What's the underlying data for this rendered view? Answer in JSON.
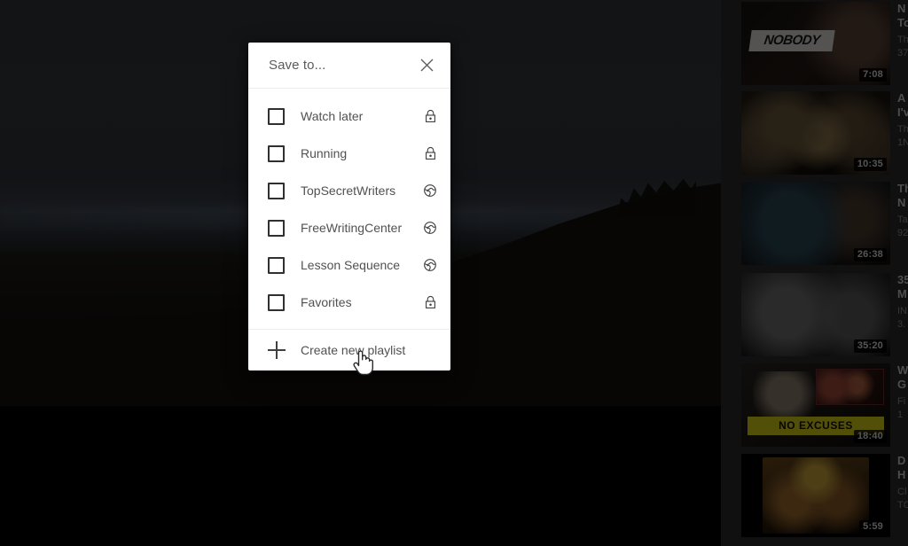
{
  "modal": {
    "title": "Save to...",
    "close_icon": "close-icon",
    "playlists": [
      {
        "label": "Watch later",
        "privacy": "private",
        "privacy_icon": "lock-icon",
        "checked": false
      },
      {
        "label": "Running",
        "privacy": "private",
        "privacy_icon": "lock-icon",
        "checked": false
      },
      {
        "label": "TopSecretWriters",
        "privacy": "public",
        "privacy_icon": "globe-icon",
        "checked": false
      },
      {
        "label": "FreeWritingCenter",
        "privacy": "public",
        "privacy_icon": "globe-icon",
        "checked": false
      },
      {
        "label": "Lesson Sequence",
        "privacy": "public",
        "privacy_icon": "globe-icon",
        "checked": false
      },
      {
        "label": "Favorites",
        "privacy": "private",
        "privacy_icon": "lock-icon",
        "checked": false
      }
    ],
    "create_label": "Create new playlist",
    "create_icon": "plus-icon"
  },
  "player": {
    "state": "playing",
    "scene": "dark dusk hillside landscape"
  },
  "sidebar": {
    "videos": [
      {
        "badge_text": "NOBODY",
        "duration": "7:08",
        "title_line1": "N",
        "title_line2": "To",
        "channel": "Th",
        "views": "37"
      },
      {
        "badge_text": "",
        "duration": "10:35",
        "title_line1": "A",
        "title_line2": "I'v",
        "channel": "Th",
        "views": "1N"
      },
      {
        "badge_text": "",
        "duration": "26:38",
        "title_line1": "Th",
        "title_line2": "N",
        "channel": "Ta",
        "views": "92"
      },
      {
        "badge_text": "",
        "duration": "35:20",
        "title_line1": "35",
        "title_line2": "M",
        "channel": "IN",
        "views": "3."
      },
      {
        "badge_text": "NO EXCUSES",
        "duration": "18:40",
        "title_line1": "W",
        "title_line2": "G",
        "channel": "Fi",
        "views": "1"
      },
      {
        "badge_text": "",
        "duration": "5:59",
        "title_line1": "D",
        "title_line2": "H",
        "channel": "Cl",
        "views": "TC"
      }
    ]
  },
  "cursor": {
    "type": "pointer-hand-cursor"
  },
  "colors": {
    "modal_bg": "#ffffff",
    "modal_text": "#515151",
    "title_text": "#5c5c5c",
    "divider": "#ececec",
    "checkbox_border": "#303030",
    "page_bg": "#2b2b2b",
    "letterbox": "#000000"
  }
}
